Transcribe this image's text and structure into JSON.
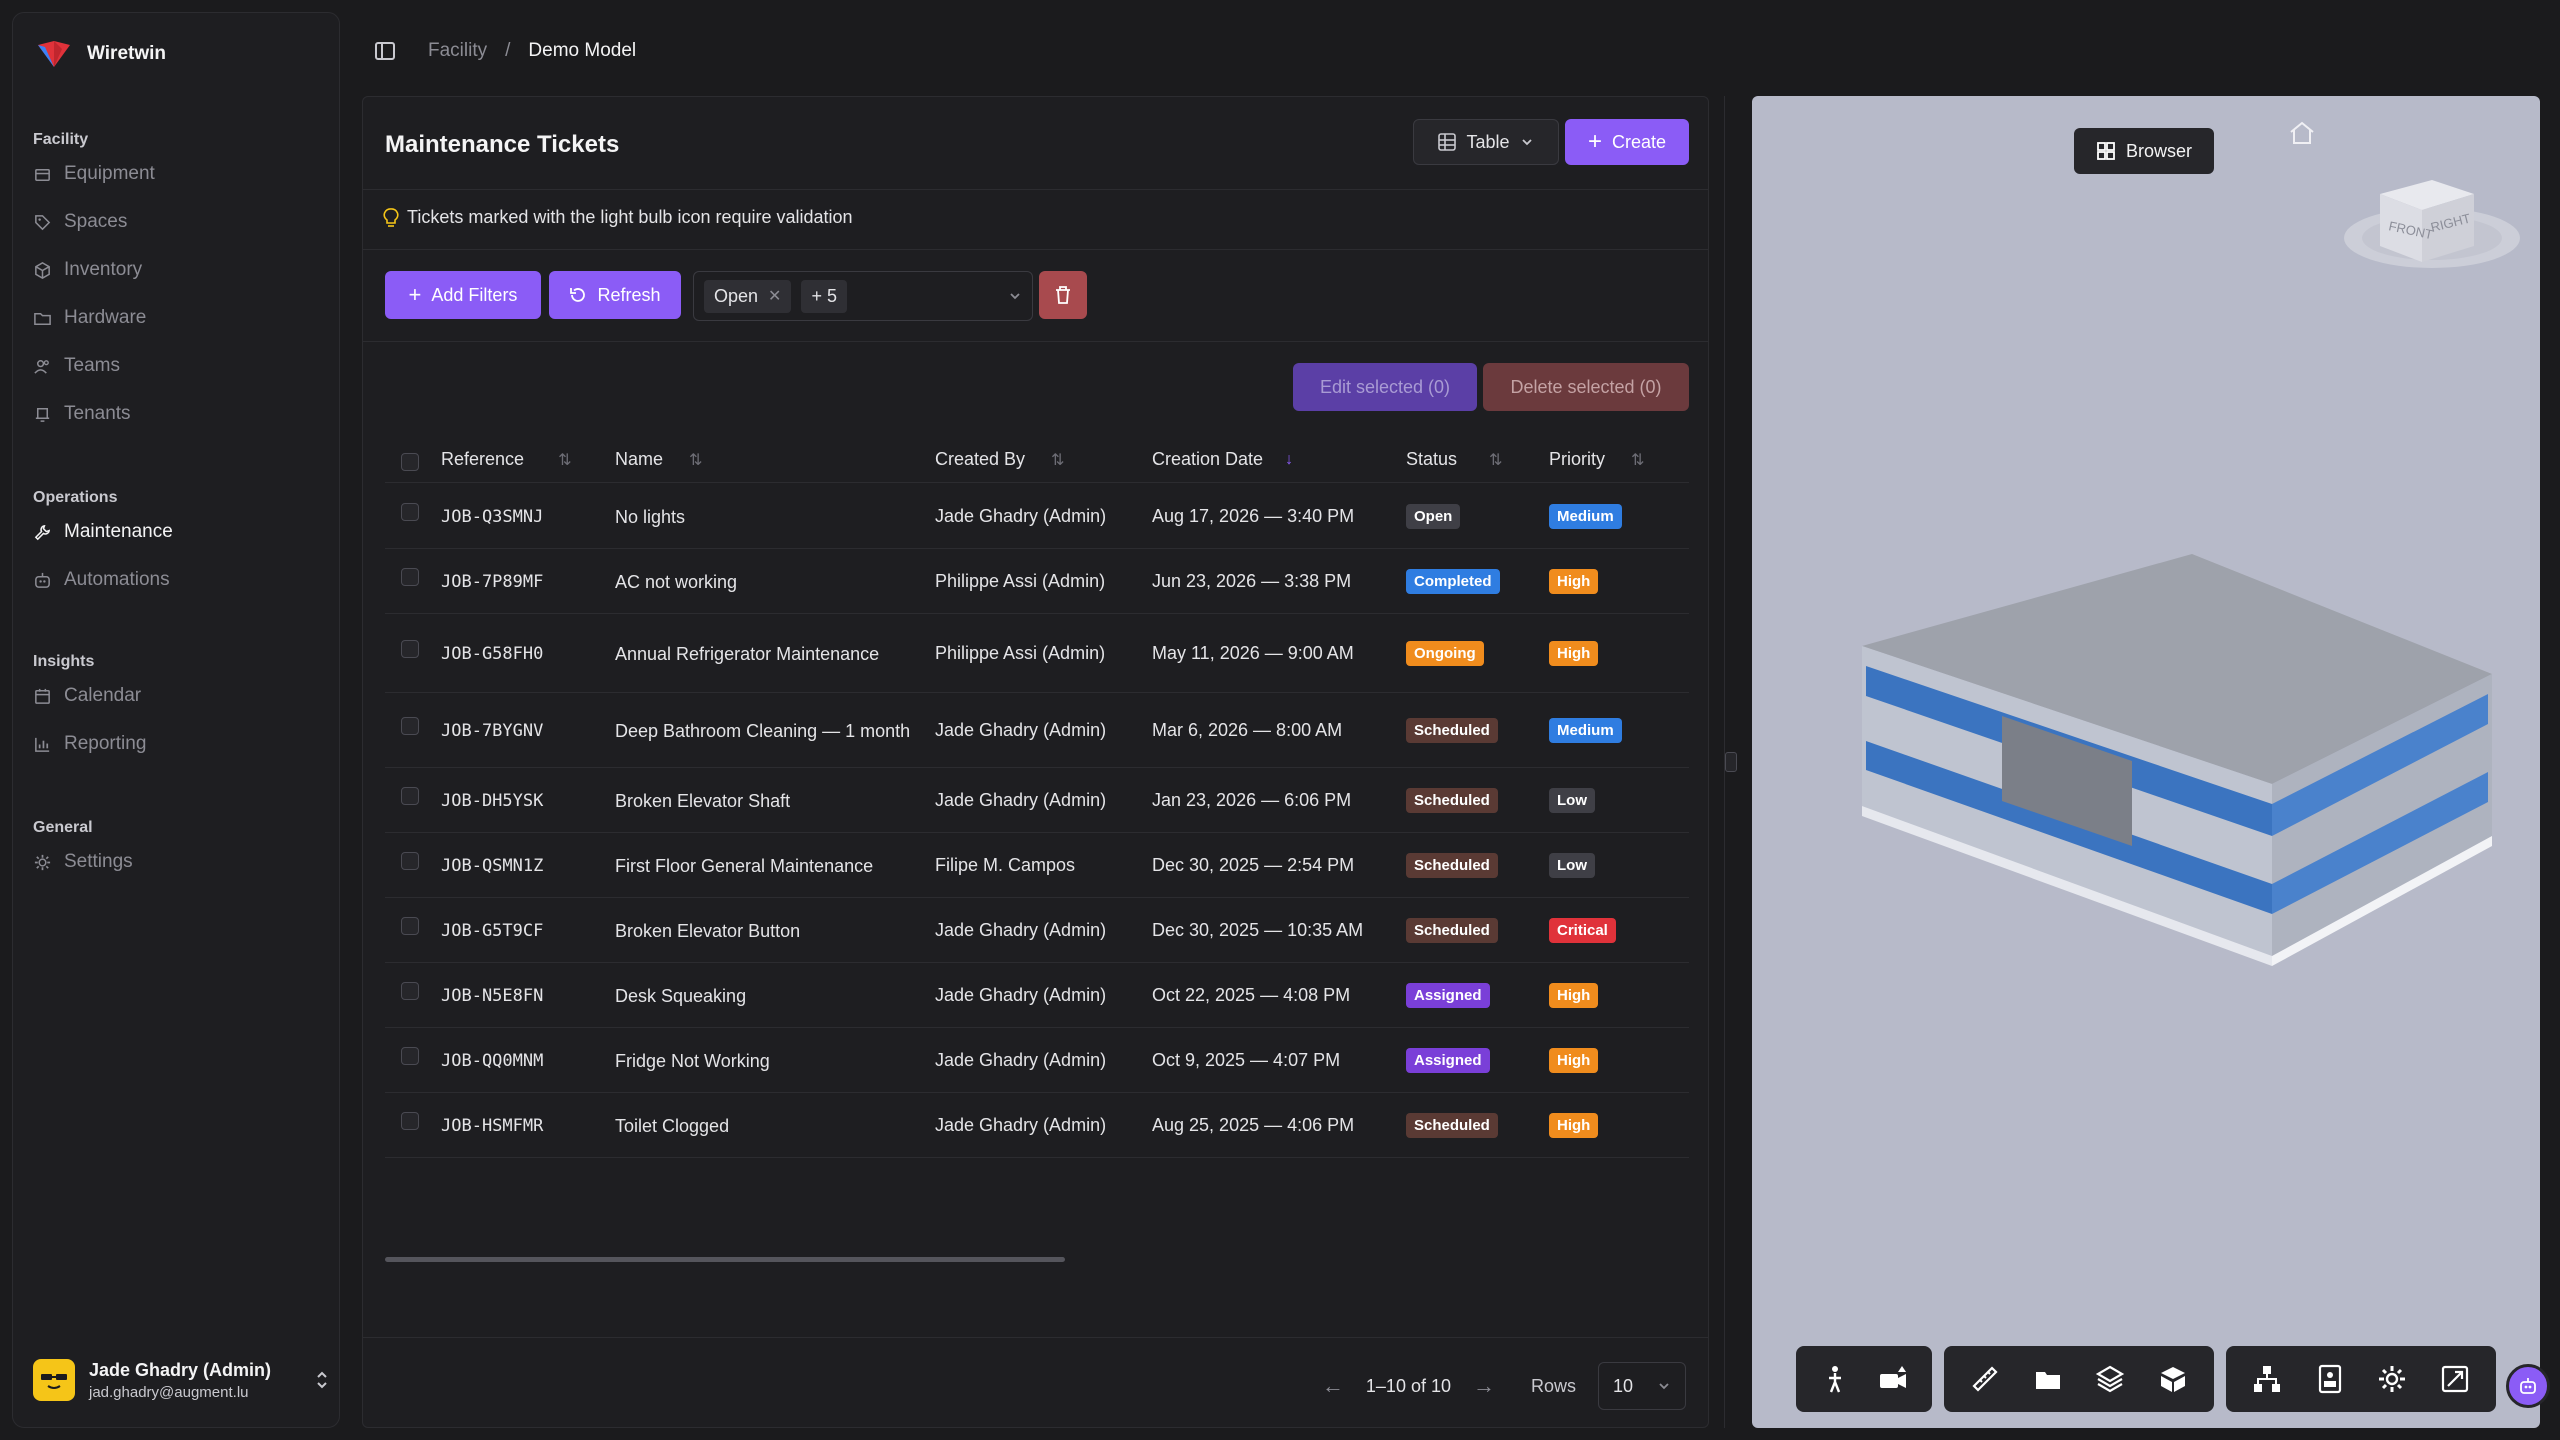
{
  "app": {
    "name": "Wiretwin"
  },
  "sidebar": {
    "groups": [
      {
        "title": "Facility",
        "items": [
          {
            "label": "Equipment",
            "icon": "box-icon"
          },
          {
            "label": "Spaces",
            "icon": "tag-icon"
          },
          {
            "label": "Inventory",
            "icon": "cube-icon"
          },
          {
            "label": "Hardware",
            "icon": "folder-icon"
          },
          {
            "label": "Teams",
            "icon": "users-icon"
          },
          {
            "label": "Tenants",
            "icon": "bell-icon"
          }
        ]
      },
      {
        "title": "Operations",
        "items": [
          {
            "label": "Maintenance",
            "icon": "wrench-icon",
            "active": true
          },
          {
            "label": "Automations",
            "icon": "robot-icon"
          }
        ]
      },
      {
        "title": "Insights",
        "items": [
          {
            "label": "Calendar",
            "icon": "calendar-icon"
          },
          {
            "label": "Reporting",
            "icon": "chart-icon"
          }
        ]
      },
      {
        "title": "General",
        "items": [
          {
            "label": "Settings",
            "icon": "gear-icon"
          }
        ]
      }
    ],
    "user": {
      "name": "Jade Ghadry (Admin)",
      "email": "jad.ghadry@augment.lu"
    }
  },
  "breadcrumb": {
    "parent": "Facility",
    "separator": "/",
    "current": "Demo Model"
  },
  "panel": {
    "title": "Maintenance Tickets",
    "view_label": "Table",
    "create_label": "Create",
    "notice": "Tickets marked with the light bulb icon require validation",
    "add_filters_label": "Add Filters",
    "refresh_label": "Refresh",
    "filter_chip": "Open",
    "filter_more": "+ 5",
    "edit_selected_label": "Edit selected (0)",
    "delete_selected_label": "Delete selected (0)"
  },
  "table": {
    "columns": [
      "Reference",
      "Name",
      "Created By",
      "Creation Date",
      "Status",
      "Priority"
    ],
    "rows": [
      {
        "ref": "JOB-Q3SMNJ",
        "name": "No lights",
        "by": "Jade Ghadry (Admin)",
        "date": "Aug 17, 2026 — 3:40 PM",
        "status": "Open",
        "priority": "Medium"
      },
      {
        "ref": "JOB-7P89MF",
        "name": "AC not working",
        "by": "Philippe Assi (Admin)",
        "date": "Jun 23, 2026 — 3:38 PM",
        "status": "Completed",
        "priority": "High"
      },
      {
        "ref": "JOB-G58FH0",
        "name": "Annual Refrigerator Maintenance",
        "by": "Philippe Assi (Admin)",
        "date": "May 11, 2026 — 9:00 AM",
        "status": "Ongoing",
        "priority": "High"
      },
      {
        "ref": "JOB-7BYGNV",
        "name": "Deep Bathroom Cleaning — 1 month",
        "by": "Jade Ghadry (Admin)",
        "date": "Mar 6, 2026 — 8:00 AM",
        "status": "Scheduled",
        "priority": "Medium"
      },
      {
        "ref": "JOB-DH5YSK",
        "name": "Broken Elevator Shaft",
        "by": "Jade Ghadry (Admin)",
        "date": "Jan 23, 2026 — 6:06 PM",
        "status": "Scheduled",
        "priority": "Low"
      },
      {
        "ref": "JOB-QSMN1Z",
        "name": "First Floor General Maintenance",
        "by": "Filipe M. Campos",
        "date": "Dec 30, 2025 — 2:54 PM",
        "status": "Scheduled",
        "priority": "Low"
      },
      {
        "ref": "JOB-G5T9CF",
        "name": "Broken Elevator Button",
        "by": "Jade Ghadry (Admin)",
        "date": "Dec 30, 2025 — 10:35 AM",
        "status": "Scheduled",
        "priority": "Critical"
      },
      {
        "ref": "JOB-N5E8FN",
        "name": "Desk Squeaking",
        "by": "Jade Ghadry (Admin)",
        "date": "Oct 22, 2025 — 4:08 PM",
        "status": "Assigned",
        "priority": "High"
      },
      {
        "ref": "JOB-QQ0MNM",
        "name": "Fridge Not Working",
        "by": "Jade Ghadry (Admin)",
        "date": "Oct 9, 2025 — 4:07 PM",
        "status": "Assigned",
        "priority": "High"
      },
      {
        "ref": "JOB-HSMFMR",
        "name": "Toilet Clogged",
        "by": "Jade Ghadry (Admin)",
        "date": "Aug 25, 2025 — 4:06 PM",
        "status": "Scheduled",
        "priority": "High"
      }
    ]
  },
  "status_colors": {
    "Open": "#3f3f46",
    "Completed": "#2f7de1",
    "Ongoing": "#f08c1d",
    "Scheduled": "#5a3a34",
    "Assigned": "#7a3fd8"
  },
  "priority_colors": {
    "Medium": "#2f7de1",
    "High": "#f08c1d",
    "Low": "#3f3f46",
    "Critical": "#e0323a"
  },
  "pagination": {
    "range": "1–10 of 10",
    "rows_label": "Rows",
    "rows_value": "10"
  },
  "viewer": {
    "browser_label": "Browser",
    "cube_labels": {
      "front": "FRONT",
      "right": "RIGHT"
    }
  },
  "accent": "#8b5cf6"
}
